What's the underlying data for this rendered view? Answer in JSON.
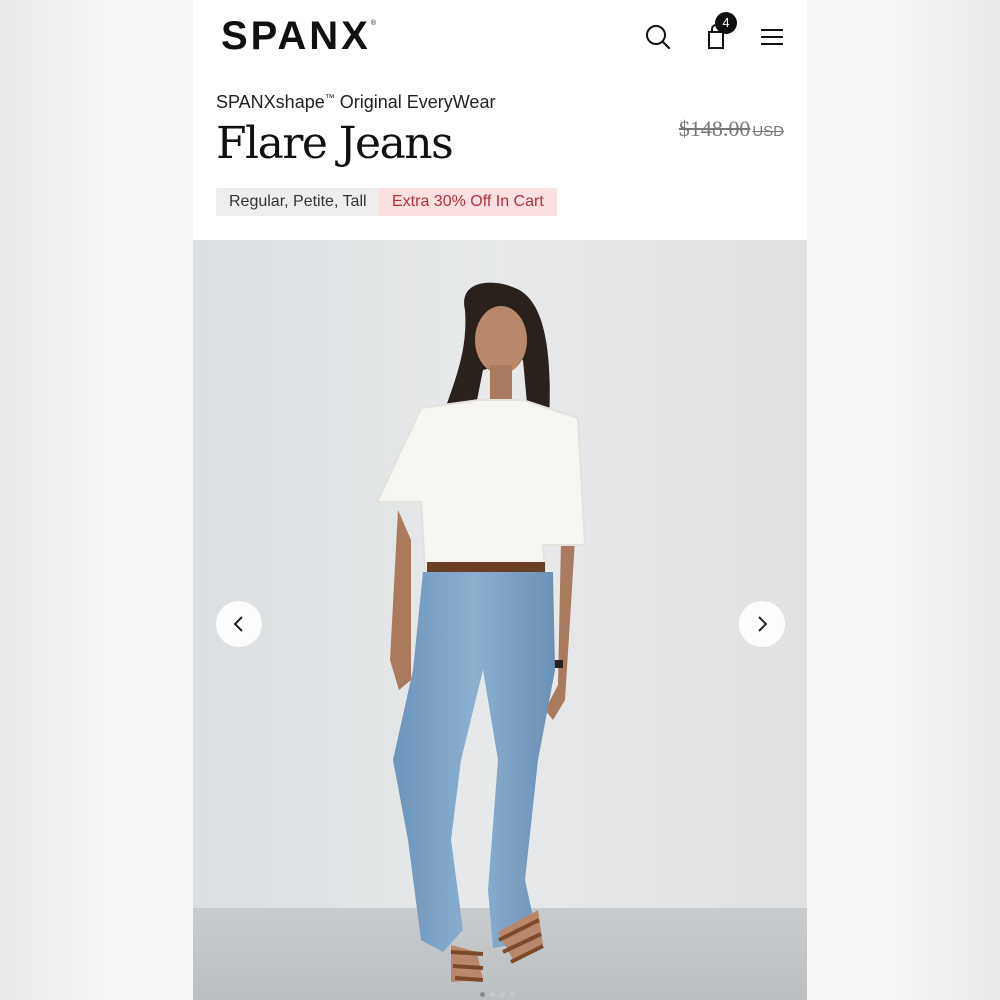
{
  "header": {
    "logo": "SPANX",
    "logo_mark": "®",
    "cart_count": "4",
    "icons": [
      "search-icon",
      "shopping-bag-icon",
      "hamburger-menu-icon"
    ]
  },
  "product": {
    "line": "SPANXshape",
    "line_tm": "™",
    "line_suffix": " Original EveryWear",
    "title": "Flare Jeans",
    "original_price": "$148.00",
    "currency": "USD",
    "sizes_tag": "Regular, Petite, Tall",
    "promo_tag": "Extra 30% Off In Cart"
  },
  "gallery": {
    "image_count": 4,
    "active_index": 0,
    "prev_icon": "chevron-left-icon",
    "next_icon": "chevron-right-icon"
  },
  "colors": {
    "promo_bg": "#fbe0e0",
    "promo_text": "#b3303b",
    "sizes_bg": "#eeeeee",
    "wall": "#e3e5e6",
    "denim": "#7fa6c8"
  }
}
